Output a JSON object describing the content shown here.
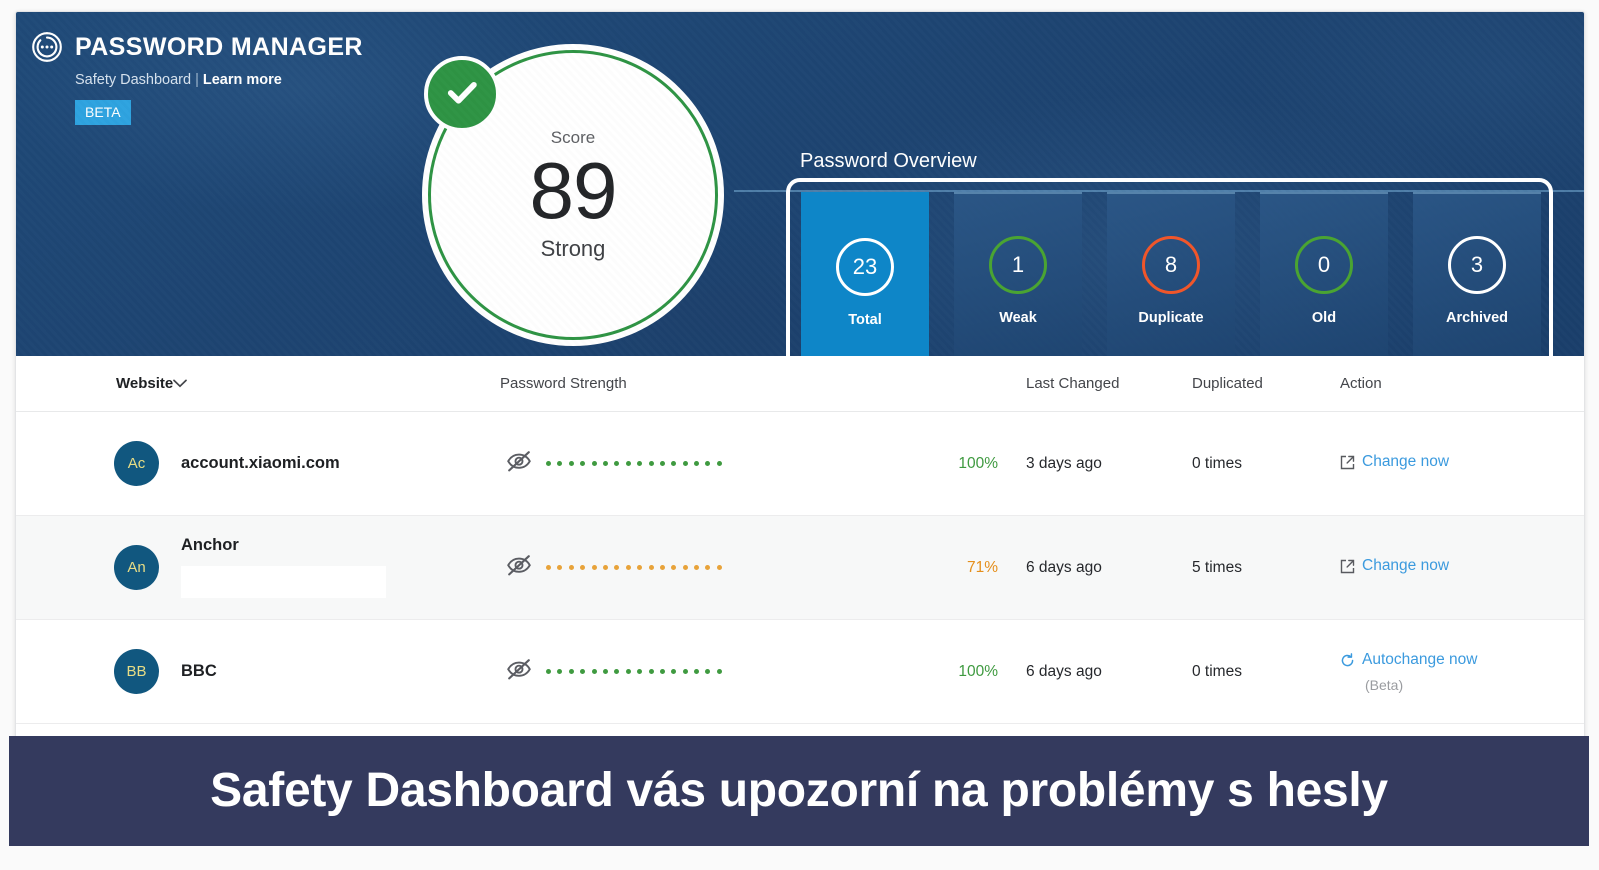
{
  "brand": {
    "title": "PASSWORD MANAGER",
    "subtitle": "Safety Dashboard",
    "separator": "|",
    "learn_more": "Learn more",
    "beta": "BETA",
    "logo_icon": "password-manager-logo-icon"
  },
  "score": {
    "label": "Score",
    "value": "89",
    "state": "Strong",
    "ring_color": "#2e9444",
    "check_icon": "check-icon",
    "check_color": "#2e9444"
  },
  "overview": {
    "title": "Password Overview",
    "cards": [
      {
        "count": "23",
        "label": "Total",
        "ring": "white",
        "ring_color": "#ffffff",
        "active": true
      },
      {
        "count": "1",
        "label": "Weak",
        "ring": "green",
        "ring_color": "#4aa432",
        "active": false
      },
      {
        "count": "8",
        "label": "Duplicate",
        "ring": "orange",
        "ring_color": "#f0562a",
        "active": false
      },
      {
        "count": "0",
        "label": "Old",
        "ring": "green",
        "ring_color": "#4aa432",
        "active": false
      },
      {
        "count": "3",
        "label": "Archived",
        "ring": "white",
        "ring_color": "#ffffff",
        "active": false
      }
    ]
  },
  "table": {
    "headers": {
      "website": "Website",
      "strength": "Password Strength",
      "percent": "",
      "last_changed": "Last Changed",
      "duplicated": "Duplicated",
      "action": "Action"
    },
    "sort_icon": "chevron-down-icon",
    "rows": [
      {
        "initials": "Ac",
        "site": "account.xiaomi.com",
        "redacted": false,
        "eye_icon": "eye-off-icon",
        "dot_color": "#3f9a40",
        "percent": "100%",
        "percent_class": "green",
        "last_changed": "3 days ago",
        "duplicated": "0 times",
        "action_label": "Change now",
        "action_icon": "external-link-icon",
        "action_sub": ""
      },
      {
        "initials": "An",
        "site": "Anchor",
        "redacted": true,
        "eye_icon": "eye-off-icon",
        "dot_color": "#e8a33a",
        "percent": "71%",
        "percent_class": "orange",
        "last_changed": "6 days ago",
        "duplicated": "5 times",
        "action_label": "Change now",
        "action_icon": "external-link-icon",
        "action_sub": ""
      },
      {
        "initials": "BB",
        "site": "BBC",
        "redacted": false,
        "eye_icon": "eye-off-icon",
        "dot_color": "#3f9a40",
        "percent": "100%",
        "percent_class": "green",
        "last_changed": "6 days ago",
        "duplicated": "0 times",
        "action_label": "Autochange now",
        "action_icon": "refresh-icon",
        "action_sub": "(Beta)"
      }
    ]
  },
  "caption": {
    "text": "Safety Dashboard vás upozorní na problémy s hesly",
    "background": "#343a5e"
  }
}
